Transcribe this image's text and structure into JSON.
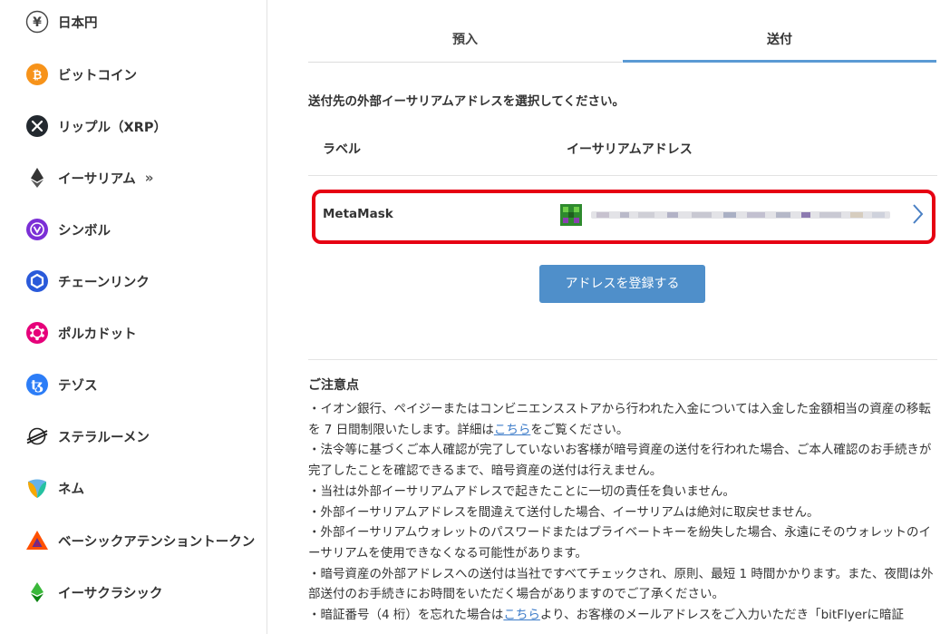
{
  "sidebar": {
    "items": [
      {
        "label": "日本円",
        "icon": "yen-icon"
      },
      {
        "label": "ビットコイン",
        "icon": "bitcoin-icon"
      },
      {
        "label": "リップル（XRP）",
        "icon": "xrp-icon"
      },
      {
        "label": "イーサリアム",
        "icon": "ethereum-icon",
        "suffix": "»"
      },
      {
        "label": "シンボル",
        "icon": "symbol-icon"
      },
      {
        "label": "チェーンリンク",
        "icon": "chainlink-icon"
      },
      {
        "label": "ポルカドット",
        "icon": "polkadot-icon"
      },
      {
        "label": "テゾス",
        "icon": "tezos-icon"
      },
      {
        "label": "ステラルーメン",
        "icon": "stellar-icon"
      },
      {
        "label": "ネム",
        "icon": "nem-icon"
      },
      {
        "label": "ベーシックアテンショントークン",
        "icon": "bat-icon"
      },
      {
        "label": "イーサクラシック",
        "icon": "ethereum-classic-icon"
      }
    ]
  },
  "tabs": {
    "deposit": "預入",
    "send": "送付",
    "active": "send"
  },
  "main": {
    "instruction": "送付先の外部イーサリアムアドレスを選択してください。",
    "table": {
      "col_label": "ラベル",
      "col_address": "イーサリアムアドレス",
      "rows": [
        {
          "label": "MetaMask",
          "address_obscured": true
        }
      ]
    },
    "register_button": "アドレスを登録する"
  },
  "notes": {
    "title": "ご注意点",
    "n1_a": "・イオン銀行、ペイジーまたはコンビニエンスストアから行われた入金については入金した金額相当の資産の移転を 7 日間制限いたします。詳細は",
    "n1_link": "こちら",
    "n1_b": "をご覧ください。",
    "n2": "・法令等に基づくご本人確認が完了していないお客様が暗号資産の送付を行われた場合、ご本人確認のお手続きが完了したことを確認できるまで、暗号資産の送付は行えません。",
    "n3": "・当社は外部イーサリアムアドレスで起きたことに一切の責任を負いません。",
    "n4": "・外部イーサリアムアドレスを間違えて送付した場合、イーサリアムは絶対に取戻せません。",
    "n5": "・外部イーサリアムウォレットのパスワードまたはプライベートキーを紛失した場合、永遠にそのウォレットのイーサリアムを使用できなくなる可能性があります。",
    "n6": "・暗号資産の外部アドレスへの送付は当社ですべてチェックされ、原則、最短 1 時間かかります。また、夜間は外部送付のお手続きにお時間をいただく場合がありますのでご了承ください。",
    "n7_a": "・暗証番号（4 桁）を忘れた場合は",
    "n7_link": "こちら",
    "n7_b": "より、お客様のメールアドレスをご入力いただき「bitFlyerに暗証"
  },
  "colors": {
    "accent": "#4f8fca",
    "tab_underline": "#5b9ad4",
    "highlight_border": "#e60012",
    "link": "#3d7cc9"
  }
}
